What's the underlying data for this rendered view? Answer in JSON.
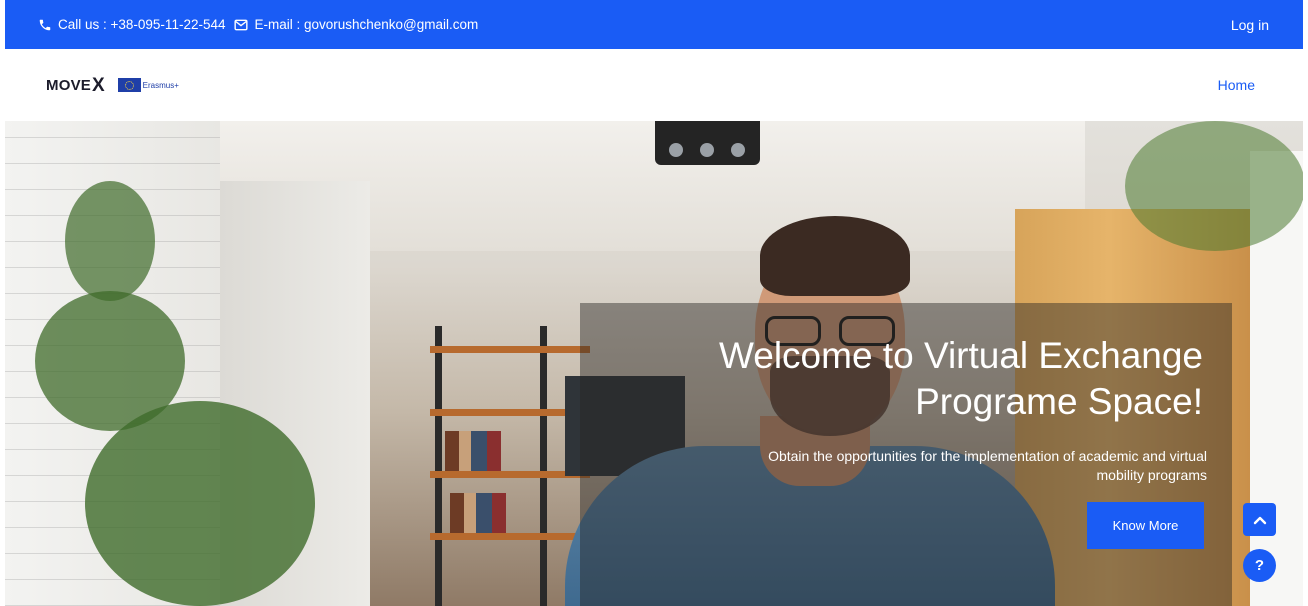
{
  "topbar": {
    "phone_text": "Call us : +38-095-11-22-544",
    "email_text": "E-mail : govorushchenko@gmail.com",
    "login_label": "Log in"
  },
  "navbar": {
    "brand_move": "MOVE",
    "brand_x": "X",
    "erasmus_label": "Erasmus+",
    "home_label": "Home"
  },
  "hero": {
    "title_line1": "Welcome to Virtual Exchange",
    "title_line2": "Programe Space!",
    "subtitle_line1": "Obtain the opportunities for the implementation of academic and virtual",
    "subtitle_line2": "mobility programs",
    "cta_label": "Know More",
    "help_label": "?"
  },
  "colors": {
    "primary": "#1a5cf5",
    "text_dark": "#1c1c2b",
    "overlay": "rgba(40,38,36,0.45)"
  },
  "icons": {
    "phone": "phone-icon",
    "email": "envelope-icon",
    "scroll_top": "chevron-up-icon",
    "help": "question-icon"
  }
}
